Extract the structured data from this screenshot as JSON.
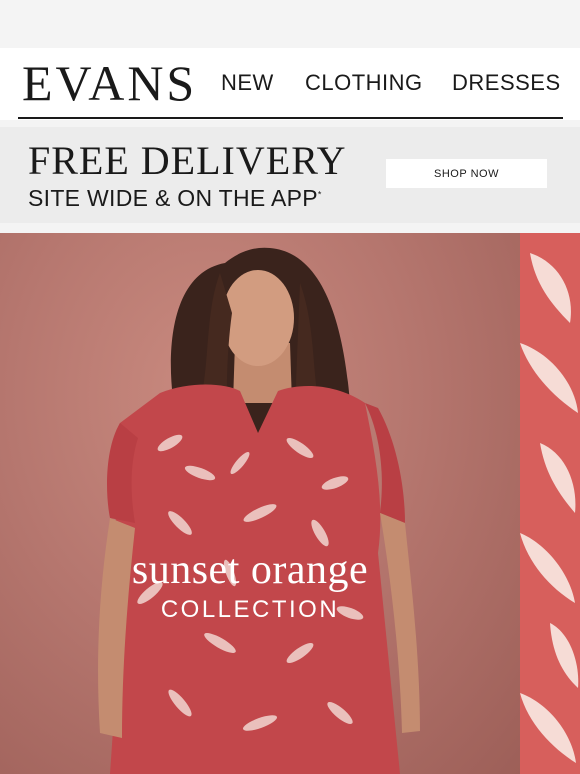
{
  "header": {
    "logo": "EVANS",
    "nav": [
      "NEW",
      "CLOTHING",
      "DRESSES"
    ]
  },
  "promo": {
    "title": "FREE DELIVERY",
    "subtitle": "SITE WIDE & ON THE APP",
    "subtitle_mark": "*",
    "button": "SHOP NOW"
  },
  "hero": {
    "title": "sunset orange",
    "subtitle": "COLLECTION"
  },
  "colors": {
    "text": "#1a1a1a",
    "promo_bg": "#ececec",
    "hero_bg": "#b6776f",
    "accent_coral": "#d75f5c"
  }
}
